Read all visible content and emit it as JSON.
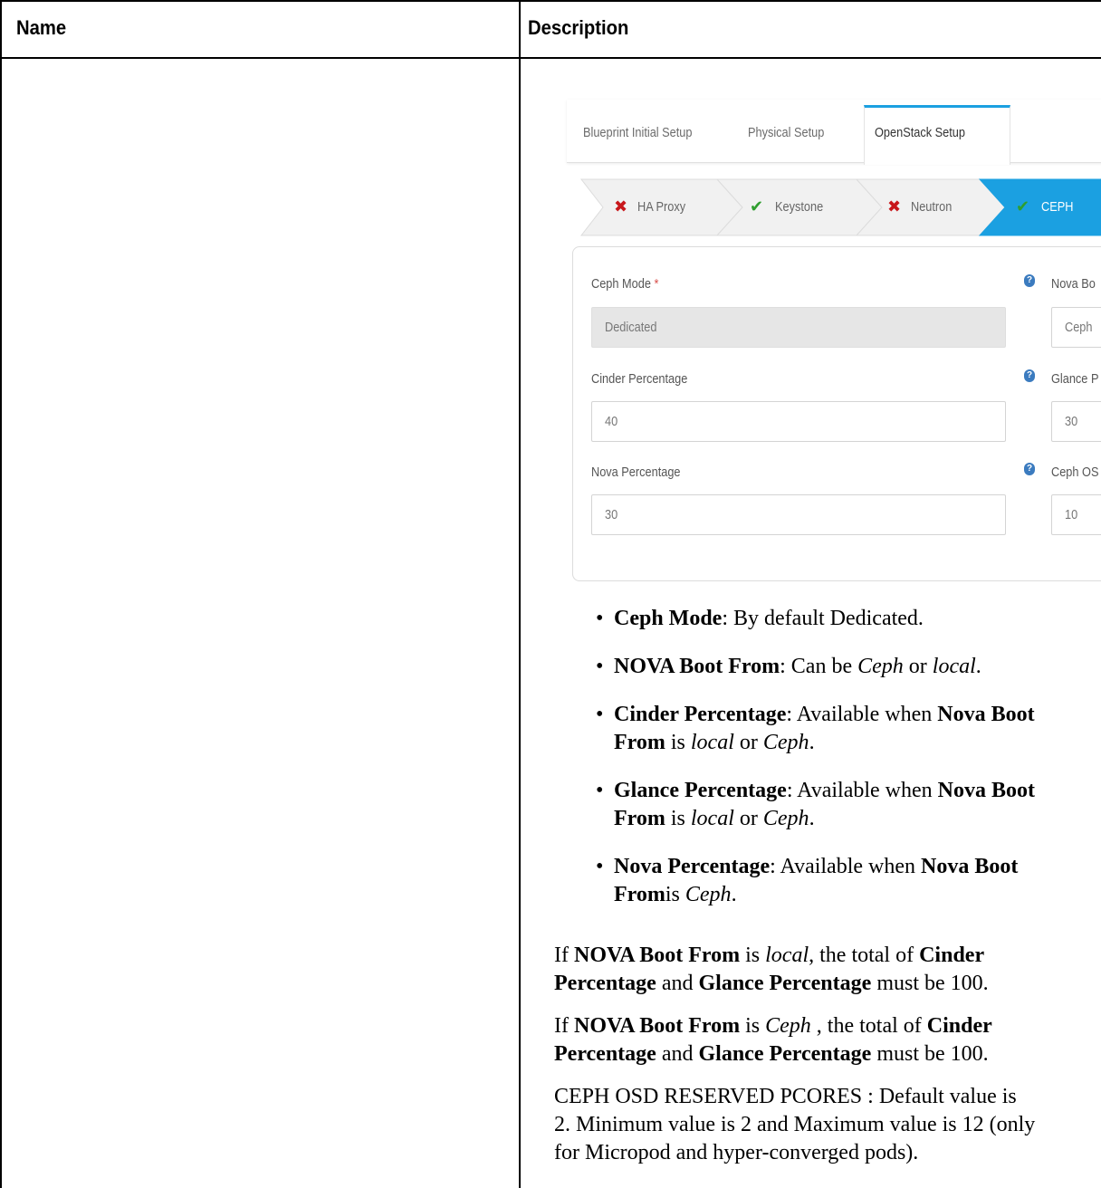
{
  "table": {
    "headers": {
      "name": "Name",
      "description": "Description"
    }
  },
  "screenshot": {
    "tabs": [
      "Blueprint Initial Setup",
      "Physical Setup",
      "OpenStack Setup"
    ],
    "active_tab": "OpenStack Setup",
    "steps": [
      {
        "label": "HA Proxy",
        "status": "error"
      },
      {
        "label": "Keystone",
        "status": "ok"
      },
      {
        "label": "Neutron",
        "status": "error"
      },
      {
        "label": "CEPH",
        "status": "ok",
        "active": true
      }
    ],
    "fields": {
      "ceph_mode": {
        "label": "Ceph Mode",
        "required_mark": "*",
        "value": "Dedicated"
      },
      "cinder_percentage": {
        "label": "Cinder Percentage",
        "value": "40"
      },
      "nova_percentage": {
        "label": "Nova Percentage",
        "value": "30"
      },
      "nova_boot_from": {
        "label": "Nova Bo",
        "value": "Ceph"
      },
      "glance_percentage": {
        "label": "Glance P",
        "value": "30"
      },
      "ceph_osd": {
        "label": "Ceph OS",
        "value": "10"
      }
    },
    "icons": {
      "info": "info-icon",
      "error": "x-mark-icon",
      "ok": "check-mark-icon"
    },
    "colors": {
      "accent": "#1ba0e1",
      "error": "#c8171b",
      "ok": "#2f9e2f",
      "info": "#3b7bbf"
    }
  },
  "bullets": [
    {
      "bold": "Ceph Mode",
      "line1": ": By default Dedicated."
    },
    {
      "bold": "NOVA Boot From",
      "line1": ": Can be ",
      "it1": "Ceph",
      "mid": " or ",
      "it2": "local",
      "end": "."
    },
    {
      "bold": "Cinder Percentage",
      "line1": ": Available when ",
      "bold2": "Nova Boot",
      "bold3": "From",
      "line2a": "  is ",
      "it1": "local",
      "mid": " or ",
      "it2": "Ceph",
      "end": "."
    },
    {
      "bold": "Glance Percentage",
      "line1": ": Available when ",
      "bold2": "Nova Boot",
      "bold3": "From",
      "line2a": " is ",
      "it1": "local",
      "mid": " or ",
      "it2": "Ceph",
      "end": "."
    },
    {
      "bold": "Nova Percentage",
      "line1": ": Available when ",
      "bold2": "Nova Boot",
      "bold3": "From",
      "line2a": "is ",
      "it1": "Ceph",
      "end": "."
    }
  ],
  "paragraphs": {
    "p1": {
      "a": "If ",
      "b1": "NOVA Boot From",
      "c": " is ",
      "i1": "local",
      "d": ", the total of ",
      "b2": "Cinder",
      "b3": "Percentage",
      "e": " and ",
      "b4": "Glance Percentage",
      "f": " must be 100."
    },
    "p2": {
      "a": "If ",
      "b1": "NOVA Boot From",
      "c": " is ",
      "i1": "Ceph",
      "d": " , the total of ",
      "b2": "Cinder",
      "b3": "Percentage",
      "e": " and ",
      "b4": "Glance Percentage",
      "f": " must be 100."
    },
    "p3": {
      "line1": "CEPH OSD RESERVED PCORES : Default value is",
      "line2": "2. Minimum value is 2 and Maximum value is 12 (only",
      "line3": "for Micropod and hyper-converged pods)."
    }
  }
}
